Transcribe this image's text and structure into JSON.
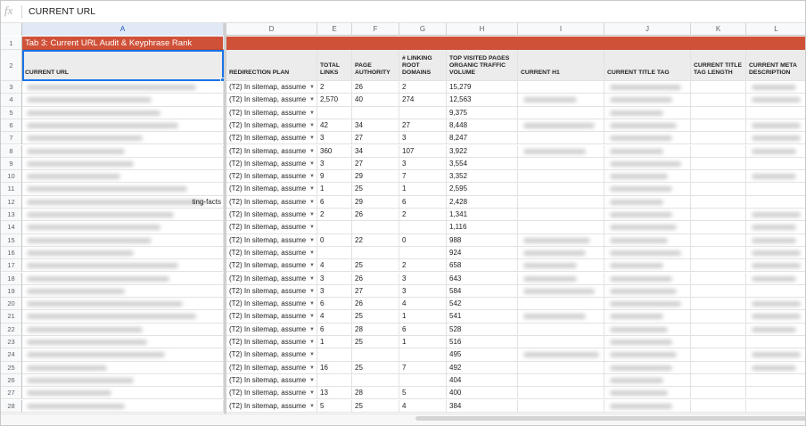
{
  "formula_bar": {
    "fx_icon": "fx",
    "value": "CURRENT URL"
  },
  "columns": [
    "A",
    "D",
    "E",
    "F",
    "G",
    "H",
    "I",
    "J",
    "K",
    "L"
  ],
  "title_cell": "Tab 3: Current URL Audit & Keyphrase Rank",
  "headers": {
    "A": "CURRENT URL",
    "D": "REDIRECTION PLAN",
    "E": "TOTAL LINKS",
    "F": "PAGE AUTHORITY",
    "G": "# LINKING ROOT DOMAINS",
    "H": "TOP VISITED PAGES ORGANIC TRAFFIC VOLUME",
    "I": "CURRENT H1",
    "J": "CURRENT TITLE TAG",
    "K": "CURRENT TITLE TAG LENGTH",
    "L": "CURRENT META DESCRIPTION"
  },
  "dropdown_value": "(T2) In sitemap, assume",
  "row_numbers": [
    "1",
    "2",
    "3",
    "4",
    "5",
    "6",
    "7",
    "8",
    "9",
    "10",
    "11",
    "12",
    "13",
    "14",
    "15",
    "16",
    "17",
    "18",
    "19",
    "20",
    "21",
    "22",
    "23",
    "24",
    "25",
    "26",
    "27",
    "28"
  ],
  "rows": [
    {
      "a_tail": "",
      "e": "2",
      "f": "26",
      "g": "2",
      "h": "15,279"
    },
    {
      "a_tail": "",
      "e": "2,570",
      "f": "40",
      "g": "274",
      "h": "12,563"
    },
    {
      "a_tail": "",
      "e": "",
      "f": "",
      "g": "",
      "h": "9,375"
    },
    {
      "a_tail": "",
      "e": "42",
      "f": "34",
      "g": "27",
      "h": "8,448"
    },
    {
      "a_tail": "",
      "e": "3",
      "f": "27",
      "g": "3",
      "h": "8,247"
    },
    {
      "a_tail": "",
      "e": "360",
      "f": "34",
      "g": "107",
      "h": "3,922"
    },
    {
      "a_tail": "",
      "e": "3",
      "f": "27",
      "g": "3",
      "h": "3,554"
    },
    {
      "a_tail": "",
      "e": "9",
      "f": "29",
      "g": "7",
      "h": "3,352"
    },
    {
      "a_tail": "",
      "e": "1",
      "f": "25",
      "g": "1",
      "h": "2,595"
    },
    {
      "a_tail": "ting-facts",
      "e": "6",
      "f": "29",
      "g": "6",
      "h": "2,428"
    },
    {
      "a_tail": "",
      "e": "2",
      "f": "26",
      "g": "2",
      "h": "1,341"
    },
    {
      "a_tail": "",
      "e": "",
      "f": "",
      "g": "",
      "h": "1,116"
    },
    {
      "a_tail": "",
      "e": "0",
      "f": "22",
      "g": "0",
      "h": "988"
    },
    {
      "a_tail": "",
      "e": "",
      "f": "",
      "g": "",
      "h": "924"
    },
    {
      "a_tail": "",
      "e": "4",
      "f": "25",
      "g": "2",
      "h": "658"
    },
    {
      "a_tail": "",
      "e": "3",
      "f": "26",
      "g": "3",
      "h": "643"
    },
    {
      "a_tail": "",
      "e": "3",
      "f": "27",
      "g": "3",
      "h": "584"
    },
    {
      "a_tail": "",
      "e": "6",
      "f": "26",
      "g": "4",
      "h": "542"
    },
    {
      "a_tail": "",
      "e": "4",
      "f": "25",
      "g": "1",
      "h": "541"
    },
    {
      "a_tail": "",
      "e": "6",
      "f": "28",
      "g": "6",
      "h": "528"
    },
    {
      "a_tail": "",
      "e": "1",
      "f": "25",
      "g": "1",
      "h": "516"
    },
    {
      "a_tail": "",
      "e": "",
      "f": "",
      "g": "",
      "h": "495"
    },
    {
      "a_tail": "",
      "e": "16",
      "f": "25",
      "g": "7",
      "h": "492"
    },
    {
      "a_tail": "",
      "e": "",
      "f": "",
      "g": "",
      "h": "404"
    },
    {
      "a_tail": "",
      "e": "13",
      "f": "28",
      "g": "5",
      "h": "400"
    },
    {
      "a_tail": "",
      "e": "5",
      "f": "25",
      "g": "4",
      "h": "384"
    }
  ],
  "colors": {
    "title_fill": "#cf5138",
    "header_fill": "#ececec",
    "selection": "#1a73e8"
  }
}
